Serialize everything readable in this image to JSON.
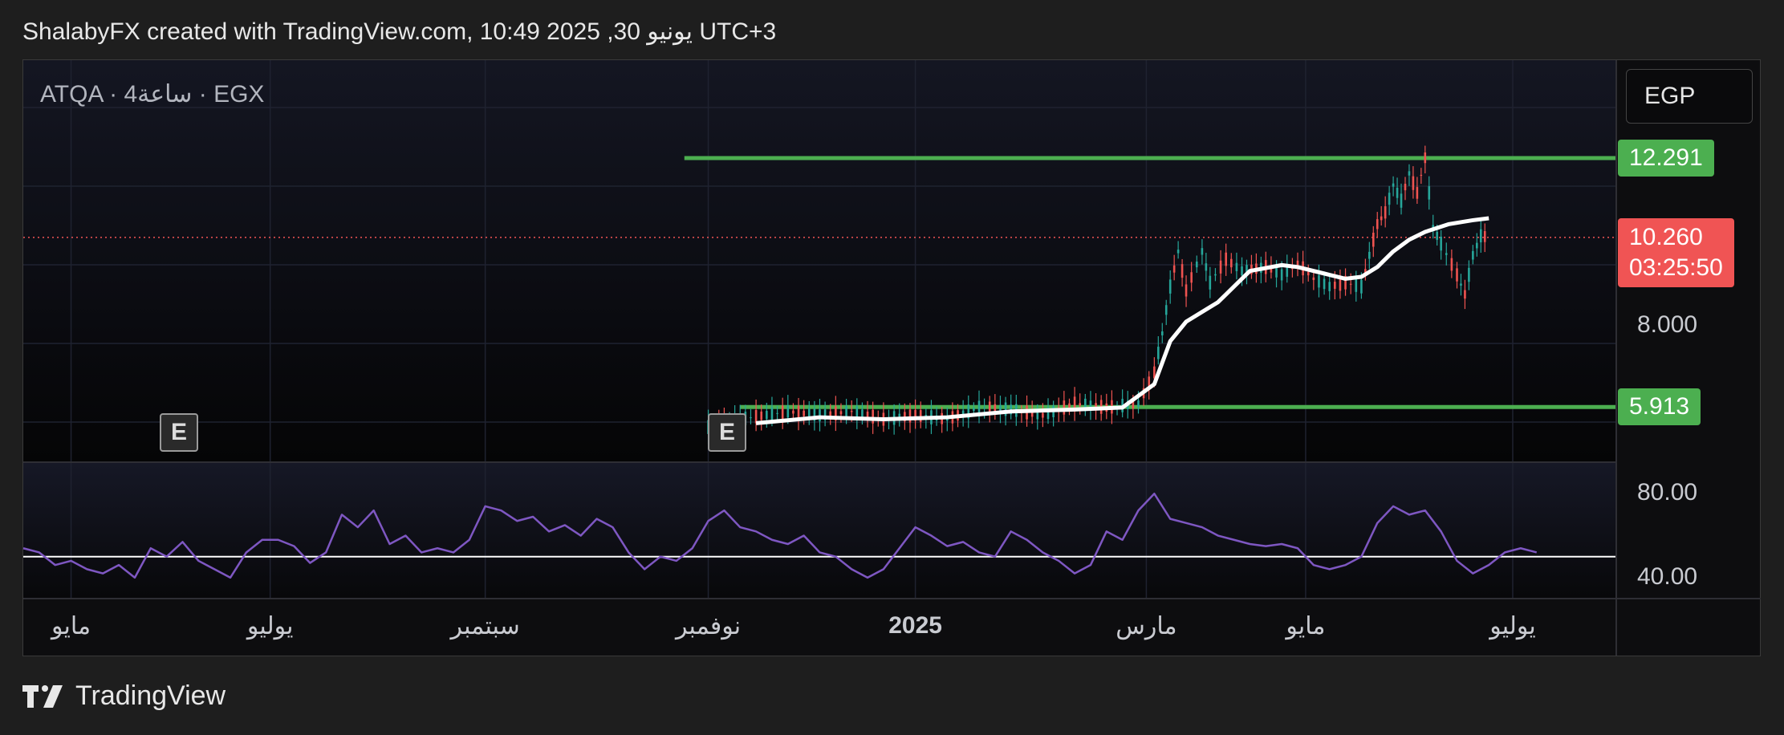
{
  "header": {
    "title": "ShalabyFX created with TradingView.com, 10:49 2025 ,30 يونيو UTC+3"
  },
  "footer": {
    "brand": "TradingView"
  },
  "colors": {
    "up": "#26a69a",
    "down": "#ef5350",
    "level": "#4caf50",
    "ma": "#ffffff",
    "rsi": "#7e57c2",
    "current": "#f05454"
  },
  "icons": {
    "logo": "tradingview-logo-icon",
    "earnings": "earnings-e-icon"
  },
  "chart_data": {
    "type": "line",
    "symbol": "ATQA · 4ساعة · EGX",
    "currency": "EGP",
    "x_ticks": [
      {
        "label": "مايو",
        "t": 0.03
      },
      {
        "label": "يوليو",
        "t": 0.155
      },
      {
        "label": "سبتمبر",
        "t": 0.29
      },
      {
        "label": "نوفمبر",
        "t": 0.43
      },
      {
        "label": "2025",
        "t": 0.56,
        "bold": true
      },
      {
        "label": "مارس",
        "t": 0.705
      },
      {
        "label": "مايو",
        "t": 0.805
      },
      {
        "label": "يوليو",
        "t": 0.935
      }
    ],
    "price_axis": {
      "range": [
        4.5,
        14.8
      ],
      "ticks": [
        "8.000"
      ]
    },
    "levels": [
      {
        "value": 12.291,
        "label": "12.291",
        "t_start": 0.415
      },
      {
        "value": 5.913,
        "label": "5.913",
        "t_start": 0.45
      }
    ],
    "current_price": {
      "value": 10.26,
      "label": "10.260",
      "countdown": "03:25:50"
    },
    "price_series": [
      [
        0.43,
        5.4
      ],
      [
        0.45,
        5.6
      ],
      [
        0.48,
        5.8
      ],
      [
        0.5,
        5.7
      ],
      [
        0.52,
        5.8
      ],
      [
        0.54,
        5.6
      ],
      [
        0.56,
        5.7
      ],
      [
        0.58,
        5.6
      ],
      [
        0.6,
        5.9
      ],
      [
        0.62,
        5.85
      ],
      [
        0.64,
        5.7
      ],
      [
        0.66,
        6.0
      ],
      [
        0.68,
        5.9
      ],
      [
        0.7,
        6.0
      ],
      [
        0.71,
        6.8
      ],
      [
        0.715,
        7.8
      ],
      [
        0.72,
        9.0
      ],
      [
        0.725,
        9.9
      ],
      [
        0.73,
        8.9
      ],
      [
        0.74,
        9.9
      ],
      [
        0.745,
        9.1
      ],
      [
        0.755,
        9.7
      ],
      [
        0.765,
        9.4
      ],
      [
        0.78,
        9.5
      ],
      [
        0.79,
        9.3
      ],
      [
        0.8,
        9.6
      ],
      [
        0.81,
        9.2
      ],
      [
        0.82,
        9.0
      ],
      [
        0.83,
        9.1
      ],
      [
        0.84,
        9.0
      ],
      [
        0.845,
        9.8
      ],
      [
        0.85,
        10.6
      ],
      [
        0.855,
        10.9
      ],
      [
        0.86,
        11.6
      ],
      [
        0.865,
        11.2
      ],
      [
        0.87,
        11.9
      ],
      [
        0.875,
        11.4
      ],
      [
        0.88,
        12.3
      ],
      [
        0.885,
        10.5
      ],
      [
        0.89,
        10.1
      ],
      [
        0.9,
        9.3
      ],
      [
        0.905,
        8.8
      ],
      [
        0.91,
        9.8
      ],
      [
        0.915,
        10.3
      ],
      [
        0.92,
        10.26
      ]
    ],
    "ma_series": [
      [
        0.46,
        5.5
      ],
      [
        0.5,
        5.65
      ],
      [
        0.54,
        5.6
      ],
      [
        0.58,
        5.65
      ],
      [
        0.62,
        5.8
      ],
      [
        0.66,
        5.85
      ],
      [
        0.69,
        5.9
      ],
      [
        0.71,
        6.5
      ],
      [
        0.72,
        7.6
      ],
      [
        0.73,
        8.1
      ],
      [
        0.75,
        8.6
      ],
      [
        0.77,
        9.4
      ],
      [
        0.79,
        9.55
      ],
      [
        0.8,
        9.5
      ],
      [
        0.82,
        9.3
      ],
      [
        0.83,
        9.2
      ],
      [
        0.84,
        9.25
      ],
      [
        0.85,
        9.5
      ],
      [
        0.86,
        9.9
      ],
      [
        0.87,
        10.2
      ],
      [
        0.88,
        10.4
      ],
      [
        0.895,
        10.6
      ],
      [
        0.91,
        10.7
      ],
      [
        0.92,
        10.75
      ]
    ],
    "rsi_axis": {
      "range": [
        30,
        95
      ],
      "ticks": [
        "80.00",
        "40.00"
      ],
      "midline": 50
    },
    "rsi_series": [
      [
        0.0,
        54
      ],
      [
        0.01,
        52
      ],
      [
        0.02,
        46
      ],
      [
        0.03,
        48
      ],
      [
        0.04,
        44
      ],
      [
        0.05,
        42
      ],
      [
        0.06,
        46
      ],
      [
        0.07,
        40
      ],
      [
        0.08,
        54
      ],
      [
        0.09,
        50
      ],
      [
        0.1,
        57
      ],
      [
        0.11,
        48
      ],
      [
        0.12,
        44
      ],
      [
        0.13,
        40
      ],
      [
        0.14,
        52
      ],
      [
        0.15,
        58
      ],
      [
        0.16,
        58
      ],
      [
        0.17,
        55
      ],
      [
        0.18,
        47
      ],
      [
        0.19,
        52
      ],
      [
        0.2,
        70
      ],
      [
        0.21,
        64
      ],
      [
        0.22,
        72
      ],
      [
        0.23,
        56
      ],
      [
        0.24,
        60
      ],
      [
        0.25,
        52
      ],
      [
        0.26,
        54
      ],
      [
        0.27,
        52
      ],
      [
        0.28,
        58
      ],
      [
        0.29,
        74
      ],
      [
        0.3,
        72
      ],
      [
        0.31,
        67
      ],
      [
        0.32,
        69
      ],
      [
        0.33,
        62
      ],
      [
        0.34,
        65
      ],
      [
        0.35,
        60
      ],
      [
        0.36,
        68
      ],
      [
        0.37,
        64
      ],
      [
        0.38,
        52
      ],
      [
        0.39,
        44
      ],
      [
        0.4,
        50
      ],
      [
        0.41,
        48
      ],
      [
        0.42,
        54
      ],
      [
        0.43,
        67
      ],
      [
        0.44,
        72
      ],
      [
        0.45,
        64
      ],
      [
        0.46,
        62
      ],
      [
        0.47,
        58
      ],
      [
        0.48,
        56
      ],
      [
        0.49,
        60
      ],
      [
        0.5,
        52
      ],
      [
        0.51,
        50
      ],
      [
        0.52,
        44
      ],
      [
        0.53,
        40
      ],
      [
        0.54,
        44
      ],
      [
        0.55,
        54
      ],
      [
        0.56,
        64
      ],
      [
        0.57,
        60
      ],
      [
        0.58,
        55
      ],
      [
        0.59,
        57
      ],
      [
        0.6,
        52
      ],
      [
        0.61,
        50
      ],
      [
        0.62,
        62
      ],
      [
        0.63,
        58
      ],
      [
        0.64,
        52
      ],
      [
        0.65,
        48
      ],
      [
        0.66,
        42
      ],
      [
        0.67,
        46
      ],
      [
        0.68,
        62
      ],
      [
        0.69,
        58
      ],
      [
        0.7,
        72
      ],
      [
        0.71,
        80
      ],
      [
        0.72,
        68
      ],
      [
        0.73,
        66
      ],
      [
        0.74,
        64
      ],
      [
        0.75,
        60
      ],
      [
        0.76,
        58
      ],
      [
        0.77,
        56
      ],
      [
        0.78,
        55
      ],
      [
        0.79,
        56
      ],
      [
        0.8,
        54
      ],
      [
        0.81,
        46
      ],
      [
        0.82,
        44
      ],
      [
        0.83,
        46
      ],
      [
        0.84,
        50
      ],
      [
        0.85,
        66
      ],
      [
        0.86,
        74
      ],
      [
        0.87,
        70
      ],
      [
        0.88,
        72
      ],
      [
        0.89,
        62
      ],
      [
        0.9,
        48
      ],
      [
        0.91,
        42
      ],
      [
        0.92,
        46
      ],
      [
        0.93,
        52
      ],
      [
        0.94,
        54
      ],
      [
        0.95,
        52
      ]
    ]
  }
}
